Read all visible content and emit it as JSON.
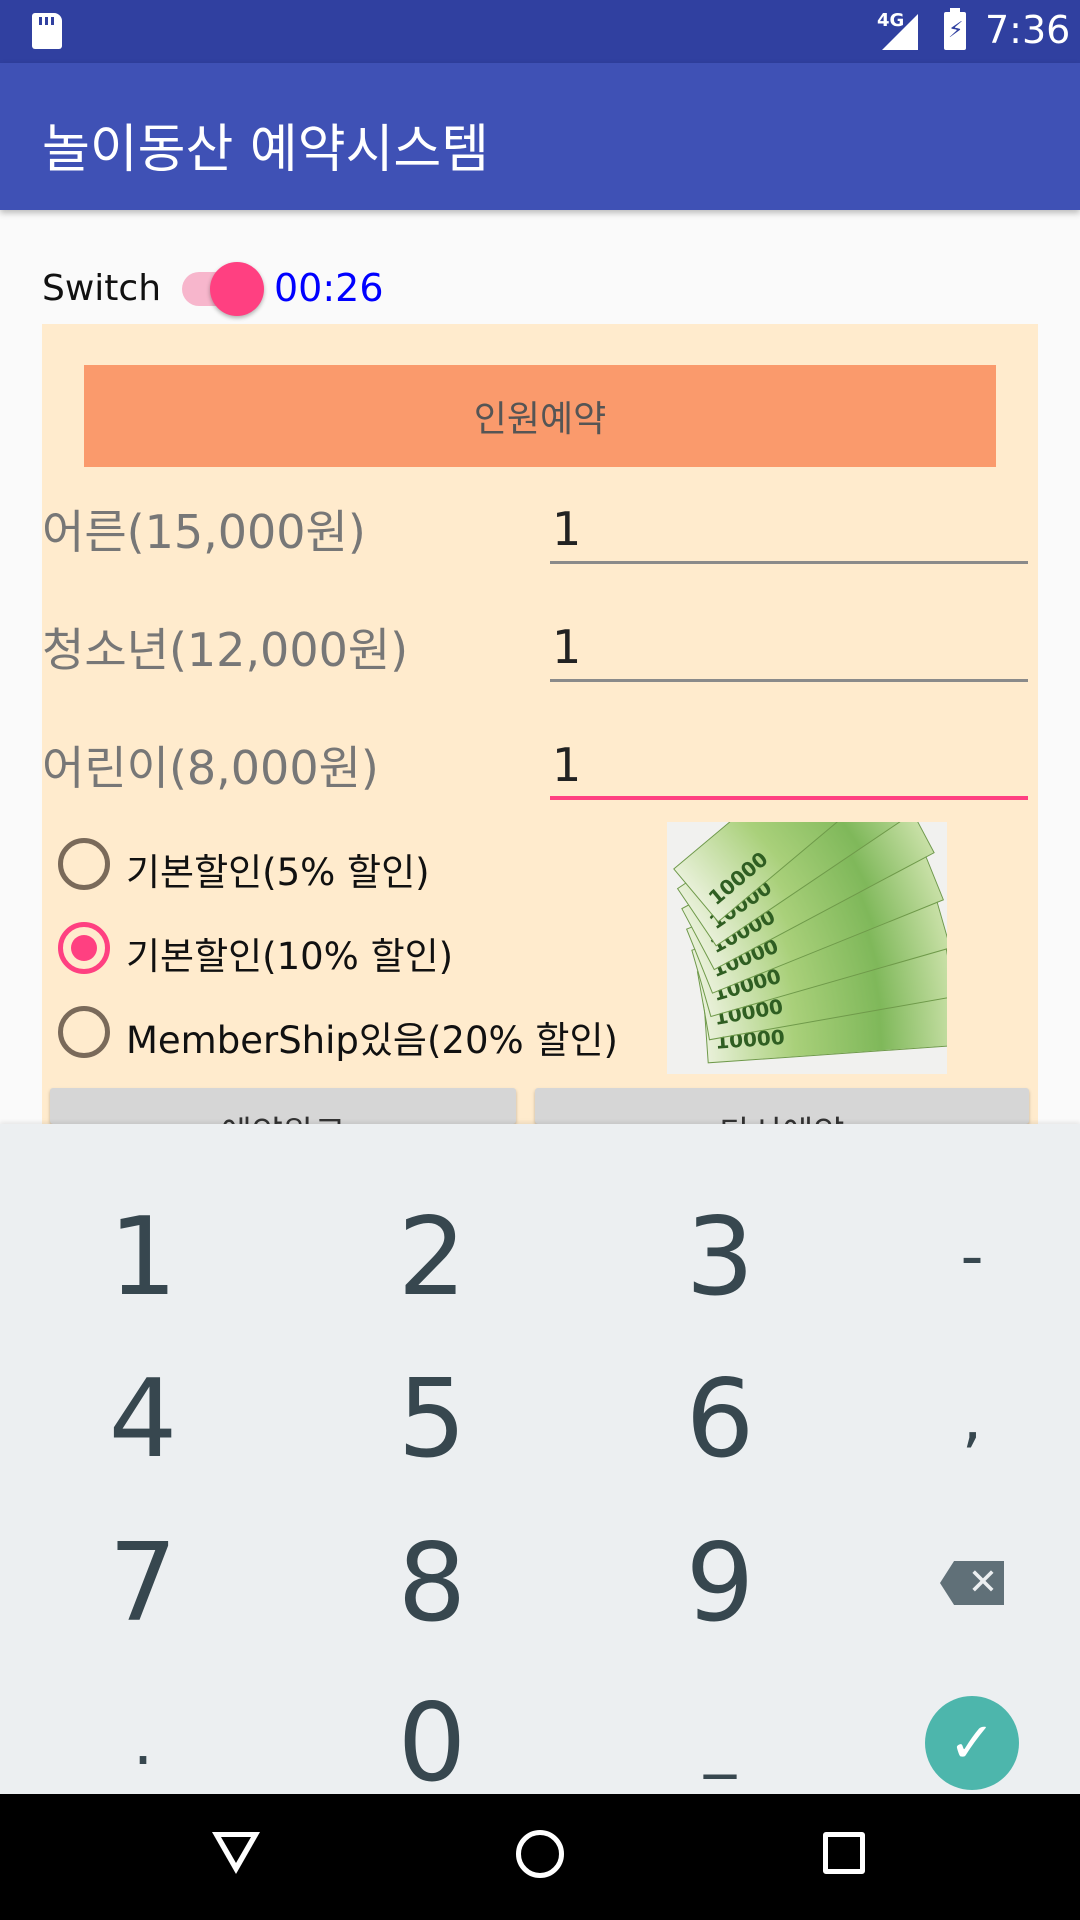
{
  "status_bar": {
    "network": "4G",
    "time": "7:36"
  },
  "app_bar": {
    "title": "놀이동산 예약시스템"
  },
  "switch_row": {
    "label": "Switch",
    "checked": true,
    "timer": "00:26"
  },
  "reservation": {
    "header_button": "인원예약",
    "rows": [
      {
        "label": "어른(15,000원)",
        "value": "1"
      },
      {
        "label": "청소년(12,000원)",
        "value": "1"
      },
      {
        "label": "어린이(8,000원)",
        "value": "1"
      }
    ],
    "discounts": [
      {
        "label": "기본할인(5% 할인)",
        "selected": false
      },
      {
        "label": "기본할인(10% 할인)",
        "selected": true
      },
      {
        "label": "MemberShip있음(20% 할인)",
        "selected": false
      }
    ],
    "image_bill_text": "10000"
  },
  "bottom_buttons": {
    "left_label": "예약완료",
    "right_label": "다시예약"
  },
  "keypad": {
    "keys": [
      "1",
      "2",
      "3",
      "-",
      "4",
      "5",
      "6",
      ",",
      "7",
      "8",
      "9",
      "backspace",
      ".",
      "0",
      "_",
      "enter"
    ]
  },
  "colors": {
    "primary": "#3f51b5",
    "accent": "#ff4081",
    "panel": "#ffebcd",
    "header_button": "#fa9a6c",
    "keypad_bg": "#eceff1"
  }
}
